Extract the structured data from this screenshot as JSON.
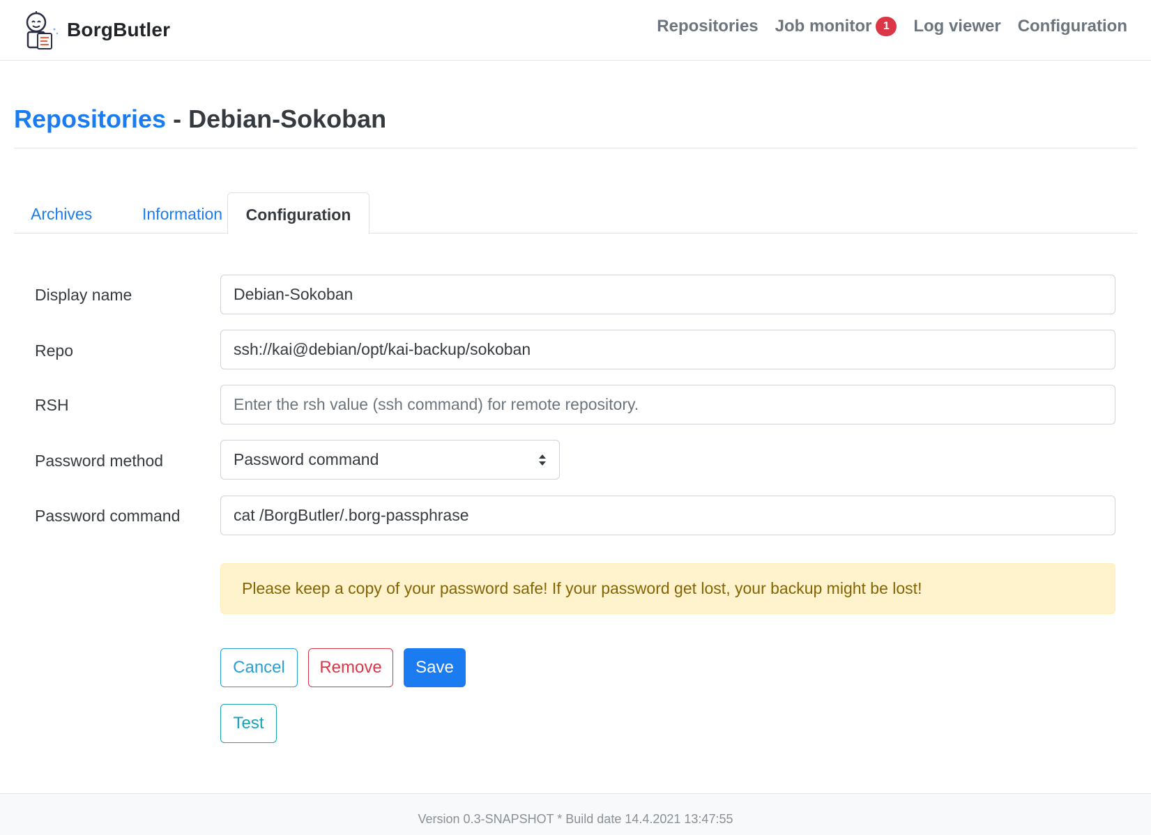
{
  "app": {
    "name": "BorgButler"
  },
  "nav": {
    "items": [
      {
        "label": "Repositories"
      },
      {
        "label": "Job monitor",
        "badge": "1"
      },
      {
        "label": "Log viewer"
      },
      {
        "label": "Configuration"
      }
    ]
  },
  "heading": {
    "breadcrumb": "Repositories",
    "separator": "-",
    "title": "Debian-Sokoban"
  },
  "tabs": [
    {
      "label": "Archives"
    },
    {
      "label": "Information"
    },
    {
      "label": "Configuration",
      "active": true
    }
  ],
  "form": {
    "display_name": {
      "label": "Display name",
      "value": "Debian-Sokoban"
    },
    "repo": {
      "label": "Repo",
      "value": "ssh://kai@debian/opt/kai-backup/sokoban"
    },
    "rsh": {
      "label": "RSH",
      "value": "",
      "placeholder": "Enter the rsh value (ssh command) for remote repository."
    },
    "password_method": {
      "label": "Password method",
      "selected": "Password command"
    },
    "password_command": {
      "label": "Password command",
      "value": "cat /BorgButler/.borg-passphrase"
    }
  },
  "alert": {
    "text": "Please keep a copy of your password safe! If your password get lost, your backup might be lost!"
  },
  "buttons": {
    "cancel": "Cancel",
    "remove": "Remove",
    "save": "Save",
    "test": "Test"
  },
  "footer": {
    "text": "Version 0.3-SNAPSHOT * Build date 14.4.2021 13:47:55"
  },
  "colors": {
    "primary": "#1a7cf0",
    "danger": "#dc3545",
    "info": "#17a2b8",
    "warning_bg": "#fff3cd",
    "warning_text": "#856404"
  }
}
